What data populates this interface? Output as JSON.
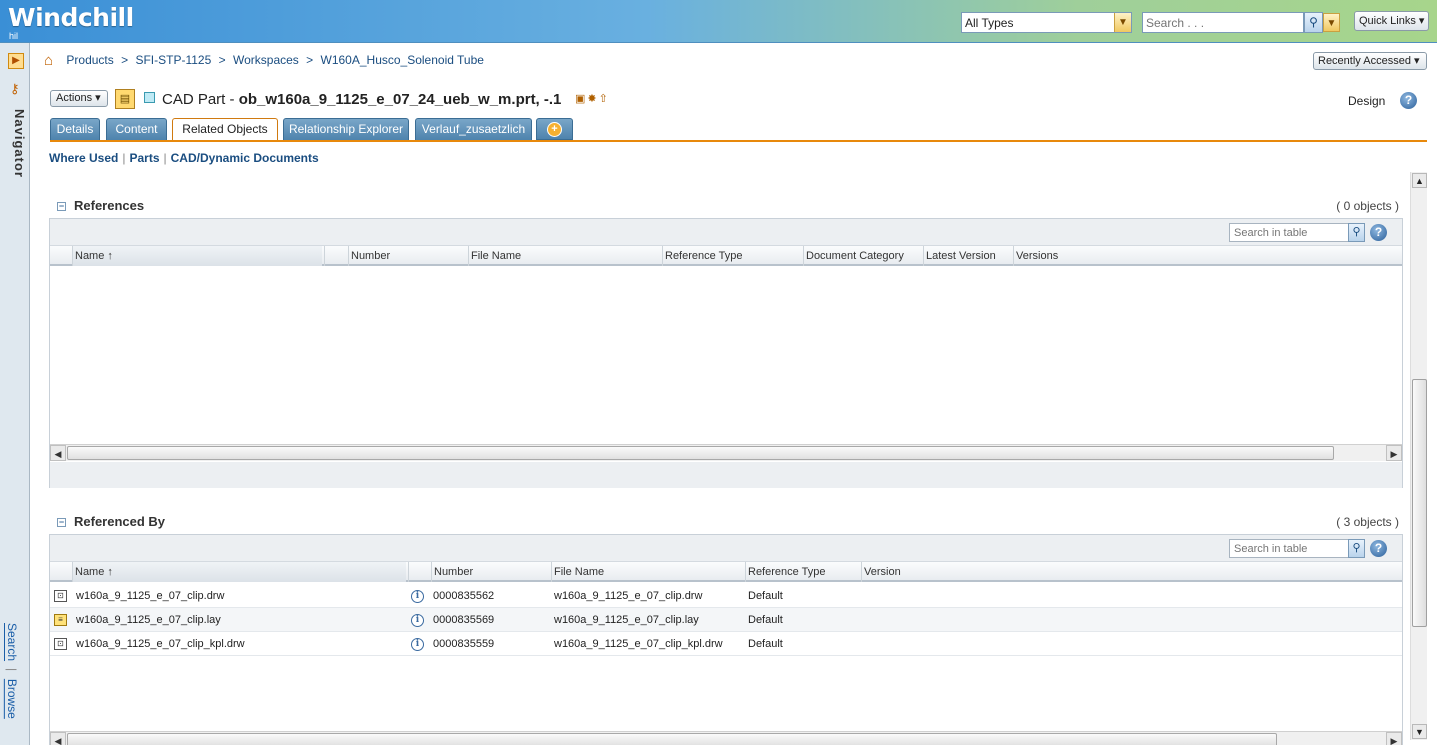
{
  "header": {
    "logo": "Windchill",
    "logo_sub": "hil",
    "type_select": "All Types",
    "search_placeholder": "Search . . .",
    "quick_links": "Quick Links ▾"
  },
  "rail": {
    "navigator": "Navigator",
    "search_link": "Search",
    "browse_link": "Browse"
  },
  "breadcrumb": {
    "items": [
      "Products",
      "SFI-STP-1125",
      "Workspaces",
      "W160A_Husco_Solenoid Tube"
    ],
    "separator": ">"
  },
  "recently_accessed": "Recently Accessed ▾",
  "page": {
    "actions": "Actions ▾",
    "type_label": "CAD Part - ",
    "object_name": "ob_w160a_9_1125_e_07_24_ueb_w_m.prt, -.1",
    "context": "Design"
  },
  "tabs": [
    "Details",
    "Content",
    "Related Objects",
    "Relationship Explorer",
    "Verlauf_zusaetzlich"
  ],
  "active_tab": "Related Objects",
  "subnav": [
    "Where Used",
    "Parts",
    "CAD/Dynamic Documents"
  ],
  "references": {
    "title": "References",
    "count": "( 0 objects )",
    "search_placeholder": "Search in table",
    "columns": [
      "Name",
      "Number",
      "File Name",
      "Reference Type",
      "Document Category",
      "Latest Version",
      "Versions"
    ],
    "sort_marker": "↑",
    "rows": []
  },
  "referenced_by": {
    "title": "Referenced By",
    "count": "( 3 objects )",
    "search_placeholder": "Search in table",
    "columns": [
      "Name",
      "Number",
      "File Name",
      "Reference Type",
      "Version"
    ],
    "sort_marker": "↑",
    "rows": [
      {
        "name": "w160a_9_1125_e_07_clip.drw",
        "number": "0000835562",
        "file_name": "w160a_9_1125_e_07_clip.drw",
        "reference_type": "Default",
        "version": "",
        "icon": "drawing-icon"
      },
      {
        "name": "w160a_9_1125_e_07_clip.lay",
        "number": "0000835569",
        "file_name": "w160a_9_1125_e_07_clip.lay",
        "reference_type": "Default",
        "version": "",
        "icon": "layout-icon"
      },
      {
        "name": "w160a_9_1125_e_07_clip_kpl.drw",
        "number": "0000835559",
        "file_name": "w160a_9_1125_e_07_clip_kpl.drw",
        "reference_type": "Default",
        "version": "",
        "icon": "drawing-icon"
      }
    ]
  },
  "colors": {
    "accent": "#e8890c",
    "tab": "#4e83ad",
    "link": "#1a4d80"
  }
}
